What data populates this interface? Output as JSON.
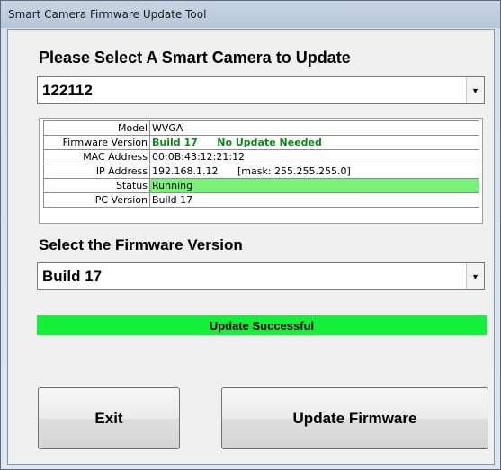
{
  "window": {
    "title": "Smart Camera Firmware Update Tool"
  },
  "camera_select": {
    "heading": "Please Select A Smart Camera to Update",
    "selected": "122112"
  },
  "info": {
    "rows": [
      {
        "label": "Model",
        "value": "WVGA"
      },
      {
        "label": "Firmware Version",
        "value": "Build 17",
        "note": "No Update Needed"
      },
      {
        "label": "MAC Address",
        "value": "00:0B:43:12:21:12"
      },
      {
        "label": "IP Address",
        "value": "192.168.1.12",
        "note": "[mask: 255.255.255.0]"
      },
      {
        "label": "Status",
        "value": "Running"
      },
      {
        "label": "PC Version",
        "value": "Build 17"
      }
    ]
  },
  "firmware_select": {
    "heading": "Select the Firmware Version",
    "selected": "Build 17"
  },
  "status_message": "Update Successful",
  "buttons": {
    "exit": "Exit",
    "update": "Update Firmware"
  },
  "colors": {
    "ok_text": "#0a8a17",
    "running_bg": "#7af27a",
    "success_bg": "#13f03a"
  }
}
